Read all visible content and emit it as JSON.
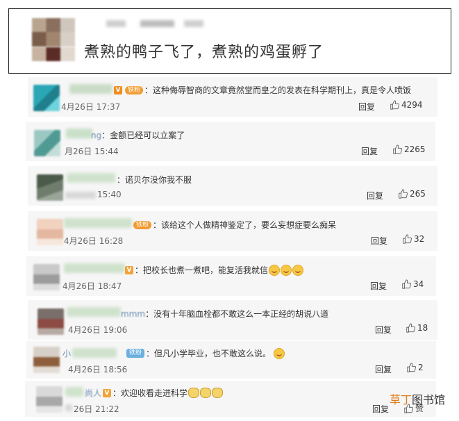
{
  "post": {
    "text": "煮熟的鸭子飞了，煮熟的鸡蛋孵了"
  },
  "comments": [
    {
      "name_visible": "",
      "text": "：这种侮辱智商的文章竟然堂而皇之的发表在科学期刊上，真是令人喷饭",
      "badge": "铁粉",
      "date": "4月26日 17:37",
      "reply": "回复",
      "likes": "4294"
    },
    {
      "name_visible": "ng",
      "text": "：金额已经可以立案了",
      "badge": "",
      "date": "月26日 15:44",
      "reply": "回复",
      "likes": "2265"
    },
    {
      "name_visible": "",
      "text": "：诺贝尔没你我不服",
      "badge": "",
      "date": "15:40",
      "reply": "回复",
      "likes": "265"
    },
    {
      "name_visible": "",
      "text": "：该给这个人做精神鉴定了，要么妄想症要么痴呆",
      "badge": "铁粉",
      "date": "4月26日 16:28",
      "reply": "回复",
      "likes": "32"
    },
    {
      "name_visible": "",
      "text": "：把校长也煮一煮吧，能复活我就信",
      "badge": "",
      "date": "4月26日 18:47",
      "reply": "回复",
      "likes": "34"
    },
    {
      "name_visible": "mmm",
      "text": "：没有十年脑血栓都不敢这么一本正经的胡说八道",
      "badge": "",
      "date": "4月26日 19:06",
      "reply": "回复",
      "likes": "18"
    },
    {
      "name_visible": "小",
      "text": "：但凡小学毕业，也不敢这么说。",
      "badge": "铁粉",
      "date": "4月26日 18:56",
      "reply": "回复",
      "likes": "2"
    },
    {
      "name_visible": "尚人",
      "text": "：欢迎收看走进科学",
      "badge": "",
      "date": "26日 21:22",
      "reply": "回复",
      "likes": "赞"
    }
  ],
  "watermark": {
    "part1": "草丁",
    "part2": "图书馆"
  },
  "colors": {
    "card_bg": "#f6f6f6",
    "fan_badge": "#f29b31",
    "iron_badge": "#6ab0e0",
    "watermark_accent": "#e07b1a"
  }
}
